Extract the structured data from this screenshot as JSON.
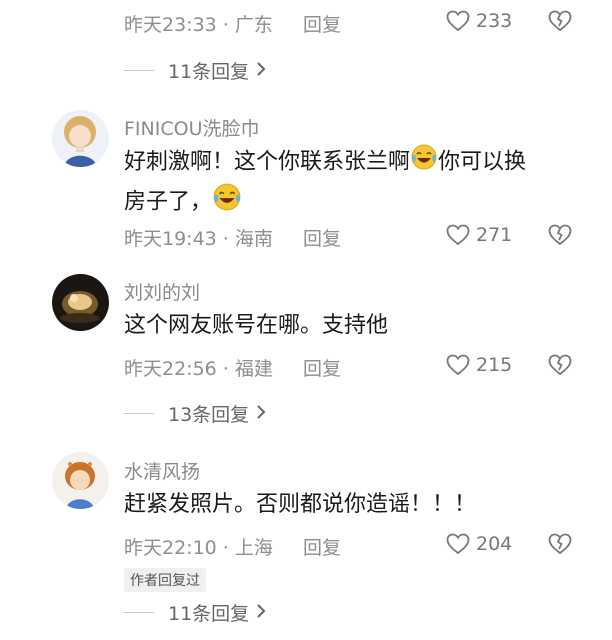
{
  "comments": [
    {
      "time": "昨天23:33 · 广东",
      "reply_label": "回复",
      "likes": "233",
      "more_replies": "11条回复"
    },
    {
      "username": "FINICOU洗脸巾",
      "text_line1_a": "好刺激啊！这个你联系张兰啊",
      "text_line1_b": "你可以换",
      "text_line2": "房子了，",
      "time": "昨天19:43 · 海南",
      "reply_label": "回复",
      "likes": "271"
    },
    {
      "username": "刘刘的刘",
      "text": "这个网友账号在哪。支持他",
      "time": "昨天22:56 · 福建",
      "reply_label": "回复",
      "likes": "215",
      "more_replies": "13条回复"
    },
    {
      "username": "水清风扬",
      "text": "赶紧发照片。否则都说你造谣！！！",
      "time": "昨天22:10 · 上海",
      "reply_label": "回复",
      "likes": "204",
      "author_badge": "作者回复过",
      "more_replies": "11条回复"
    }
  ],
  "icons": {
    "like": "heart-outline-icon",
    "dislike": "broken-heart-icon",
    "expand": "chevron-right-icon"
  }
}
